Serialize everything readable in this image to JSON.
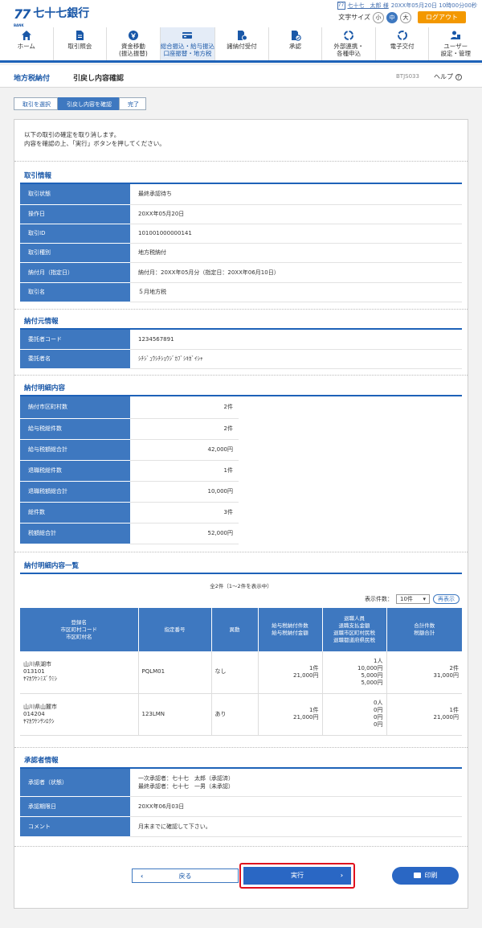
{
  "header": {
    "bank_name": "七十七銀行",
    "logo_mark": "77",
    "logo_sub": "BANK",
    "user_icon": "77",
    "user_name": "七十七　太郎 様",
    "last_login": "20XX年05月20日 10時00分00秒",
    "font_size_label": "文字サイズ",
    "font_small": "小",
    "font_medium": "中",
    "font_large": "大",
    "logout": "ログアウト"
  },
  "nav": {
    "items": [
      {
        "label": "ホーム",
        "icon": "home-icon"
      },
      {
        "label": "取引照会",
        "icon": "document-icon"
      },
      {
        "label": "資金移動\n(振込振替)",
        "icon": "transfer-icon"
      },
      {
        "label": "総合振込・給与振込\n口座振替・地方税",
        "icon": "card-icon"
      },
      {
        "label": "諸納付受付",
        "icon": "pay-icon"
      },
      {
        "label": "承認",
        "icon": "approve-icon"
      },
      {
        "label": "外部連携・\n各種申込",
        "icon": "link-icon"
      },
      {
        "label": "電子交付",
        "icon": "delivery-icon"
      },
      {
        "label": "ユーザー\n設定・管理",
        "icon": "user-settings-icon"
      }
    ]
  },
  "title": {
    "main": "地方税納付",
    "sub": "引戻し内容確認",
    "screen_id": "BTJS033",
    "help": "ヘルプ"
  },
  "steps": [
    "取引を選択",
    "引戻し内容を確認",
    "完了"
  ],
  "intro": {
    "line1": "以下の取引の確定を取り消します。",
    "line2": "内容を確認の上、「実行」ボタンを押してください。"
  },
  "sections": {
    "transaction": "取引情報",
    "payer": "納付元情報",
    "detail": "納付明細内容",
    "detail_list": "納付明細内容一覧",
    "approver": "承認者情報"
  },
  "transaction": [
    {
      "label": "取引状態",
      "value": "最終承認待ち"
    },
    {
      "label": "操作日",
      "value": "20XX年05月20日"
    },
    {
      "label": "取引ID",
      "value": "101001000000141"
    },
    {
      "label": "取引種別",
      "value": "地方税納付"
    },
    {
      "label": "納付月（指定日）",
      "value": "納付月：20XX年05月分（指定日：20XX年06月10日）"
    },
    {
      "label": "取引名",
      "value": "５月地方税"
    }
  ],
  "payer": [
    {
      "label": "委託者コード",
      "value": "1234567891"
    },
    {
      "label": "委託者名",
      "value": "ｼﾁｼﾞｭｳｼﾁｼｮｳｼﾞｶﾌﾞｼｷｶﾞｲｼｬ"
    }
  ],
  "detail": [
    {
      "label": "納付市区町村数",
      "value": "2件"
    },
    {
      "label": "給与税総件数",
      "value": "2件"
    },
    {
      "label": "給与税額総合計",
      "value": "42,000円"
    },
    {
      "label": "退職税総件数",
      "value": "1件"
    },
    {
      "label": "退職税額総合計",
      "value": "10,000円"
    },
    {
      "label": "総件数",
      "value": "3件"
    },
    {
      "label": "税額総合計",
      "value": "52,000円"
    }
  ],
  "list": {
    "count_text": "全2件（1～2件を表示中）",
    "display_count_label": "表示件数：",
    "display_count": "10件",
    "redisplay": "再表示",
    "headers": [
      "登録名\n市区町村コード\n市区町村名",
      "指定番号",
      "異動",
      "給与税納付件数\n給与税納付金額",
      "退職人員\n退職支払金額\n退職市区町村民税\n退職都道府県民税",
      "合計件数\n税額合計"
    ],
    "rows": [
      {
        "name": "山川県湖市\n013101\nﾔﾏｶﾜｹﾝﾐｽﾞｳﾐｼ",
        "number": "PQLM01",
        "change": "なし",
        "salary": "1件\n21,000円",
        "retire": "1人\n10,000円\n5,000円\n5,000円",
        "total": "2件\n31,000円"
      },
      {
        "name": "山川県山麓市\n014204\nﾔﾏｶﾜｹﾝｻﾝﾛｸｼ",
        "number": "123LMN",
        "change": "あり",
        "salary": "1件\n21,000円",
        "retire": "0人\n0円\n0円\n0円",
        "total": "1件\n21,000円"
      }
    ]
  },
  "approver": [
    {
      "label": "承認者（状態）",
      "value": "一次承認者：七十七　太郎（承認済）\n最終承認者：七十七　一男（未承認）"
    },
    {
      "label": "承認期限日",
      "value": "20XX年06月03日"
    },
    {
      "label": "コメント",
      "value": "月末までに確認して下さい。"
    }
  ],
  "buttons": {
    "back": "戻る",
    "execute": "実行",
    "print": "印刷"
  }
}
